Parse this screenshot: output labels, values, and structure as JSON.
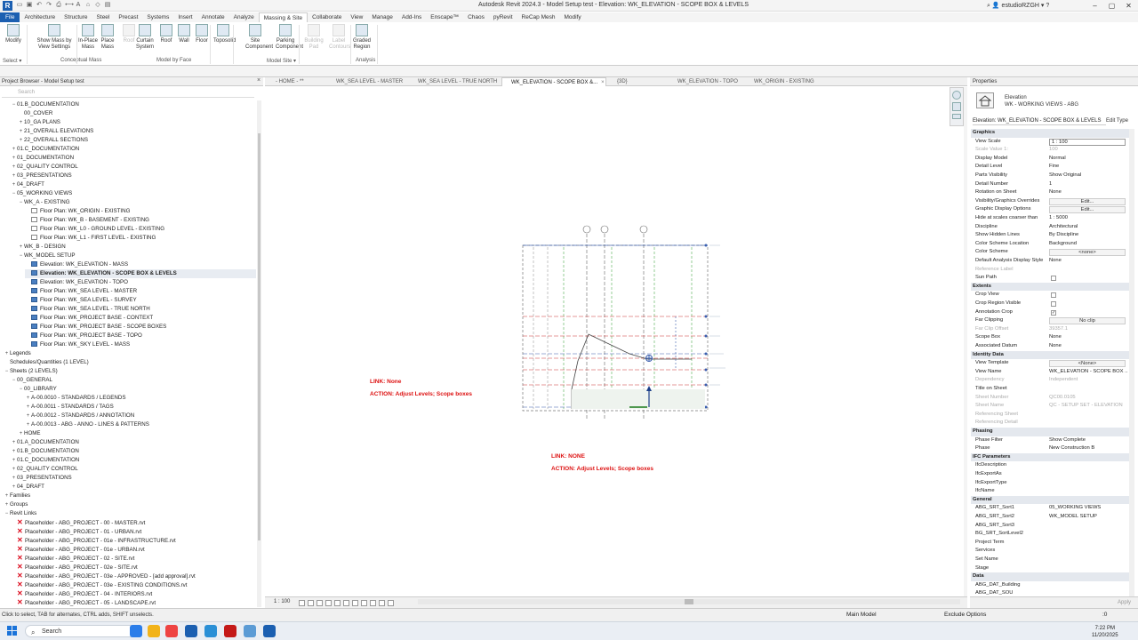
{
  "app": {
    "title": "Autodesk Revit 2024.3 - Model Setup test - Elevation: WK_ELEVATION - SCOPE BOX & LEVELS",
    "user": "estudioRZGH",
    "logo": "R"
  },
  "ribbon_tabs": [
    "File",
    "Architecture",
    "Structure",
    "Steel",
    "Precast",
    "Systems",
    "Insert",
    "Annotate",
    "Analyze",
    "Massing & Site",
    "Collaborate",
    "View",
    "Manage",
    "Add-Ins",
    "Enscape™",
    "Chaos",
    "pyRevit",
    "ReCap Mesh",
    "Modify"
  ],
  "ribbon_active_tab": "Massing & Site",
  "ribbon": {
    "buttons": [
      {
        "label": "Modify",
        "enabled": true
      },
      {
        "label": "Show Mass by View Settings",
        "enabled": true
      },
      {
        "label": "In-Place Mass",
        "enabled": true
      },
      {
        "label": "Place Mass",
        "enabled": true
      },
      {
        "label": "Roof",
        "enabled": false
      },
      {
        "label": "Curtain System",
        "enabled": true
      },
      {
        "label": "Roof",
        "enabled": true
      },
      {
        "label": "Wall",
        "enabled": true
      },
      {
        "label": "Floor",
        "enabled": true
      },
      {
        "label": "Toposolid",
        "enabled": true
      },
      {
        "label": "Site Component",
        "enabled": true
      },
      {
        "label": "Parking Component",
        "enabled": true
      },
      {
        "label": "Building Pad",
        "enabled": false
      },
      {
        "label": "Label Contours",
        "enabled": false
      },
      {
        "label": "Graded Region",
        "enabled": true
      }
    ],
    "panels": [
      "Select ▾",
      "Conceptual Mass",
      "Model by Face",
      "Model Site ▾",
      "Analysis"
    ]
  },
  "project_browser": {
    "title": "Project Browser - Model Setup test",
    "search_placeholder": "Search",
    "rows": [
      {
        "t": "−",
        "ic": "",
        "label": "01.B_DOCUMENTATION",
        "lvl": 1
      },
      {
        "t": "",
        "ic": "",
        "label": "00_COVER",
        "lvl": 2
      },
      {
        "t": "+",
        "ic": "",
        "label": "10_GA PLANS",
        "lvl": 2
      },
      {
        "t": "+",
        "ic": "",
        "label": "21_OVERALL ELEVATIONS",
        "lvl": 2
      },
      {
        "t": "+",
        "ic": "",
        "label": "22_OVERALL SECTIONS",
        "lvl": 2
      },
      {
        "t": "+",
        "ic": "",
        "label": "01.C_DOCUMENTATION",
        "lvl": 1
      },
      {
        "t": "+",
        "ic": "",
        "label": "01_DOCUMENTATION",
        "lvl": 1
      },
      {
        "t": "+",
        "ic": "",
        "label": "02_QUALITY CONTROL",
        "lvl": 1
      },
      {
        "t": "+",
        "ic": "",
        "label": "03_PRESENTATIONS",
        "lvl": 1
      },
      {
        "t": "+",
        "ic": "",
        "label": "04_DRAFT",
        "lvl": 1
      },
      {
        "t": "−",
        "ic": "",
        "label": "05_WORKING VIEWS",
        "lvl": 1
      },
      {
        "t": "−",
        "ic": "",
        "label": "WK_A - EXISTING",
        "lvl": 2
      },
      {
        "t": "",
        "ic": "fp",
        "label": "Floor Plan: WK_ORIGIN - EXISTING",
        "lvl": 3
      },
      {
        "t": "",
        "ic": "fp",
        "label": "Floor Plan: WK_B - BASEMENT - EXISTING",
        "lvl": 3
      },
      {
        "t": "",
        "ic": "fp",
        "label": "Floor Plan: WK_L0 - GROUND LEVEL - EXISTING",
        "lvl": 3
      },
      {
        "t": "",
        "ic": "fp",
        "label": "Floor Plan: WK_L1 - FIRST LEVEL - EXISTING",
        "lvl": 3
      },
      {
        "t": "+",
        "ic": "",
        "label": "WK_B - DESIGN",
        "lvl": 2
      },
      {
        "t": "−",
        "ic": "",
        "label": "WK_MODEL SETUP",
        "lvl": 2
      },
      {
        "t": "",
        "ic": "v",
        "label": "Elevation: WK_ELEVATION - MASS",
        "lvl": 3
      },
      {
        "t": "",
        "ic": "v",
        "label": "Elevation: WK_ELEVATION - SCOPE BOX & LEVELS",
        "lvl": 3,
        "sel": true
      },
      {
        "t": "",
        "ic": "v",
        "label": "Elevation: WK_ELEVATION - TOPO",
        "lvl": 3
      },
      {
        "t": "",
        "ic": "v",
        "label": "Floor Plan: WK_SEA LEVEL - MASTER",
        "lvl": 3
      },
      {
        "t": "",
        "ic": "v",
        "label": "Floor Plan: WK_SEA LEVEL - SURVEY",
        "lvl": 3
      },
      {
        "t": "",
        "ic": "v",
        "label": "Floor Plan: WK_SEA LEVEL - TRUE NORTH",
        "lvl": 3
      },
      {
        "t": "",
        "ic": "v",
        "label": "Floor Plan: WK_PROJECT BASE - CONTEXT",
        "lvl": 3
      },
      {
        "t": "",
        "ic": "v",
        "label": "Floor Plan: WK_PROJECT BASE - SCOPE BOXES",
        "lvl": 3
      },
      {
        "t": "",
        "ic": "v",
        "label": "Floor Plan: WK_PROJECT BASE - TOPO",
        "lvl": 3
      },
      {
        "t": "",
        "ic": "v",
        "label": "Floor Plan: WK_SKY LEVEL - MASS",
        "lvl": 3
      },
      {
        "t": "+",
        "ic": "",
        "label": "Legends",
        "lvl": 0
      },
      {
        "t": "",
        "ic": "",
        "label": "Schedules/Quantities (1 LEVEL)",
        "lvl": 0
      },
      {
        "t": "−",
        "ic": "",
        "label": "Sheets (2 LEVELS)",
        "lvl": 0
      },
      {
        "t": "−",
        "ic": "",
        "label": "00_GENERAL",
        "lvl": 1
      },
      {
        "t": "−",
        "ic": "",
        "label": "00_LIBRARY",
        "lvl": 2
      },
      {
        "t": "+",
        "ic": "",
        "label": "A-00.0010 - STANDARDS / LEGENDS",
        "lvl": 3
      },
      {
        "t": "+",
        "ic": "",
        "label": "A-00.0011 - STANDARDS / TAGS",
        "lvl": 3
      },
      {
        "t": "+",
        "ic": "",
        "label": "A-00.0012 - STANDARDS / ANNOTATION",
        "lvl": 3
      },
      {
        "t": "+",
        "ic": "",
        "label": "A-00.0013 - ABG - ANNO - LINES & PATTERNS",
        "lvl": 3
      },
      {
        "t": "+",
        "ic": "",
        "label": "HOME",
        "lvl": 2
      },
      {
        "t": "+",
        "ic": "",
        "label": "01.A_DOCUMENTATION",
        "lvl": 1
      },
      {
        "t": "+",
        "ic": "",
        "label": "01.B_DOCUMENTATION",
        "lvl": 1
      },
      {
        "t": "+",
        "ic": "",
        "label": "01.C_DOCUMENTATION",
        "lvl": 1
      },
      {
        "t": "+",
        "ic": "",
        "label": "02_QUALITY CONTROL",
        "lvl": 1
      },
      {
        "t": "+",
        "ic": "",
        "label": "03_PRESENTATIONS",
        "lvl": 1
      },
      {
        "t": "+",
        "ic": "",
        "label": "04_DRAFT",
        "lvl": 1
      },
      {
        "t": "+",
        "ic": "",
        "label": "Families",
        "lvl": 0
      },
      {
        "t": "+",
        "ic": "",
        "label": "Groups",
        "lvl": 0
      },
      {
        "t": "−",
        "ic": "",
        "label": "Revit Links",
        "lvl": 0
      },
      {
        "t": "",
        "ic": "x",
        "label": "Placeholder - ABG_PROJECT - 00 - MASTER.rvt",
        "lvl": 1
      },
      {
        "t": "",
        "ic": "x",
        "label": "Placeholder - ABG_PROJECT - 01 - URBAN.rvt",
        "lvl": 1
      },
      {
        "t": "",
        "ic": "x",
        "label": "Placeholder - ABG_PROJECT - 01e - INFRASTRUCTURE.rvt",
        "lvl": 1
      },
      {
        "t": "",
        "ic": "x",
        "label": "Placeholder - ABG_PROJECT - 01e - URBAN.rvt",
        "lvl": 1
      },
      {
        "t": "",
        "ic": "x",
        "label": "Placeholder - ABG_PROJECT - 02 - SITE.rvt",
        "lvl": 1
      },
      {
        "t": "",
        "ic": "x",
        "label": "Placeholder - ABG_PROJECT - 02e - SITE.rvt",
        "lvl": 1
      },
      {
        "t": "",
        "ic": "x",
        "label": "Placeholder - ABG_PROJECT - 03e - APPROVED - [add approval].rvt",
        "lvl": 1
      },
      {
        "t": "",
        "ic": "x",
        "label": "Placeholder - ABG_PROJECT - 03e - EXISTING CONDITIONS.rvt",
        "lvl": 1
      },
      {
        "t": "",
        "ic": "x",
        "label": "Placeholder - ABG_PROJECT - 04 - INTERIORS.rvt",
        "lvl": 1
      },
      {
        "t": "",
        "ic": "x",
        "label": "Placeholder - ABG_PROJECT - 05 - LANDSCAPE.rvt",
        "lvl": 1
      }
    ]
  },
  "view_tabs": [
    {
      "label": "- HOME - **",
      "active": false
    },
    {
      "label": "WK_SEA LEVEL - MASTER",
      "active": false
    },
    {
      "label": "WK_SEA LEVEL - TRUE NORTH",
      "active": false
    },
    {
      "label": "WK_ELEVATION - SCOPE BOX &...",
      "active": true
    },
    {
      "label": "{3D}",
      "active": false
    },
    {
      "label": "WK_ELEVATION - TOPO",
      "active": false
    },
    {
      "label": "WK_ORIGIN - EXISTING",
      "active": false
    }
  ],
  "canvas": {
    "note1_link": "LINK: None",
    "note1_action": "ACTION: Adjust Levels; Scope boxes",
    "note2_link": "LINK: NONE",
    "note2_action": "ACTION: Adjust Levels; Scope boxes",
    "note_color": "#d11111",
    "grid_bubbles": [
      "",
      "",
      ""
    ]
  },
  "view_control": {
    "scale": "1 : 100"
  },
  "properties": {
    "title": "Properties",
    "type_family": "Elevation",
    "type_name": "WK - WORKING VIEWS - ABG",
    "selector": "Elevation: WK_ELEVATION - SCOPE BOX & LEVELS",
    "edit_type": "Edit Type",
    "rows": [
      {
        "kind": "sec",
        "k": "Graphics"
      },
      {
        "k": "View Scale",
        "v": "1 : 100",
        "box": true
      },
      {
        "k": "Scale Value    1:",
        "v": "100",
        "dim": true
      },
      {
        "k": "Display Model",
        "v": "Normal"
      },
      {
        "k": "Detail Level",
        "v": "Fine"
      },
      {
        "k": "Parts Visibility",
        "v": "Show Original"
      },
      {
        "k": "Detail Number",
        "v": "1"
      },
      {
        "k": "Rotation on Sheet",
        "v": "None"
      },
      {
        "k": "Visibility/Graphics Overrides",
        "v": "Edit...",
        "btn": true
      },
      {
        "k": "Graphic Display Options",
        "v": "Edit...",
        "btn": true
      },
      {
        "k": "Hide at scales coarser than",
        "v": "1 : 5000"
      },
      {
        "k": "Discipline",
        "v": "Architectural"
      },
      {
        "k": "Show Hidden Lines",
        "v": "By Discipline"
      },
      {
        "k": "Color Scheme Location",
        "v": "Background"
      },
      {
        "k": "Color Scheme",
        "v": "<none>",
        "btn": true
      },
      {
        "k": "Default Analysis Display Style",
        "v": "None"
      },
      {
        "k": "Reference Label",
        "v": "",
        "dim": true
      },
      {
        "k": "Sun Path",
        "v": "",
        "cb": "off"
      },
      {
        "kind": "sec",
        "k": "Extents"
      },
      {
        "k": "Crop View",
        "v": "",
        "cb": "off"
      },
      {
        "k": "Crop Region Visible",
        "v": "",
        "cb": "off"
      },
      {
        "k": "Annotation Crop",
        "v": "",
        "cb": "on"
      },
      {
        "k": "Far Clipping",
        "v": "No clip",
        "btn": true
      },
      {
        "k": "Far Clip Offset",
        "v": "39357.1",
        "dim": true
      },
      {
        "k": "Scope Box",
        "v": "None"
      },
      {
        "k": "Associated Datum",
        "v": "None"
      },
      {
        "kind": "sec",
        "k": "Identity Data"
      },
      {
        "k": "View Template",
        "v": "<None>",
        "btn": true
      },
      {
        "k": "View Name",
        "v": "WK_ELEVATION - SCOPE BOX ..."
      },
      {
        "k": "Dependency",
        "v": "Independent",
        "dim": true
      },
      {
        "k": "Title on Sheet",
        "v": ""
      },
      {
        "k": "Sheet Number",
        "v": "QC00.0105",
        "dim": true
      },
      {
        "k": "Sheet Name",
        "v": "QC - SETUP SET - ELEVATION",
        "dim": true
      },
      {
        "k": "Referencing Sheet",
        "v": "",
        "dim": true
      },
      {
        "k": "Referencing Detail",
        "v": "",
        "dim": true
      },
      {
        "kind": "sec",
        "k": "Phasing"
      },
      {
        "k": "Phase Filter",
        "v": "Show Complete"
      },
      {
        "k": "Phase",
        "v": "New Construction B"
      },
      {
        "kind": "sec",
        "k": "IFC Parameters"
      },
      {
        "k": "IfcDescription",
        "v": ""
      },
      {
        "k": "IfcExportAs",
        "v": ""
      },
      {
        "k": "IfcExportType",
        "v": ""
      },
      {
        "k": "IfcName",
        "v": ""
      },
      {
        "kind": "sec",
        "k": "General"
      },
      {
        "k": "ABG_SRT_Sort1",
        "v": "05_WORKING VIEWS"
      },
      {
        "k": "ABG_SRT_Sort2",
        "v": "WK_MODEL SETUP"
      },
      {
        "k": "ABG_SRT_Sort3",
        "v": ""
      },
      {
        "k": "BG_SRT_SortLevel2",
        "v": ""
      },
      {
        "k": "Project Term",
        "v": ""
      },
      {
        "k": "Services",
        "v": ""
      },
      {
        "k": "Set Name",
        "v": ""
      },
      {
        "k": "Stage",
        "v": ""
      },
      {
        "kind": "sec",
        "k": "Data"
      },
      {
        "k": "ABG_DAT_Building",
        "v": ""
      },
      {
        "k": "ABG_DAT_SOU",
        "v": ""
      }
    ],
    "apply": "Apply"
  },
  "status": {
    "message": "Click to select, TAB for alternates, CTRL adds, SHIFT unselects.",
    "workset": "Main Model",
    "exclude": "Exclude Options",
    "count": ":0"
  },
  "taskbar": {
    "search_placeholder": "Search",
    "time": "7:22 PM",
    "date": "11/20/2025"
  }
}
